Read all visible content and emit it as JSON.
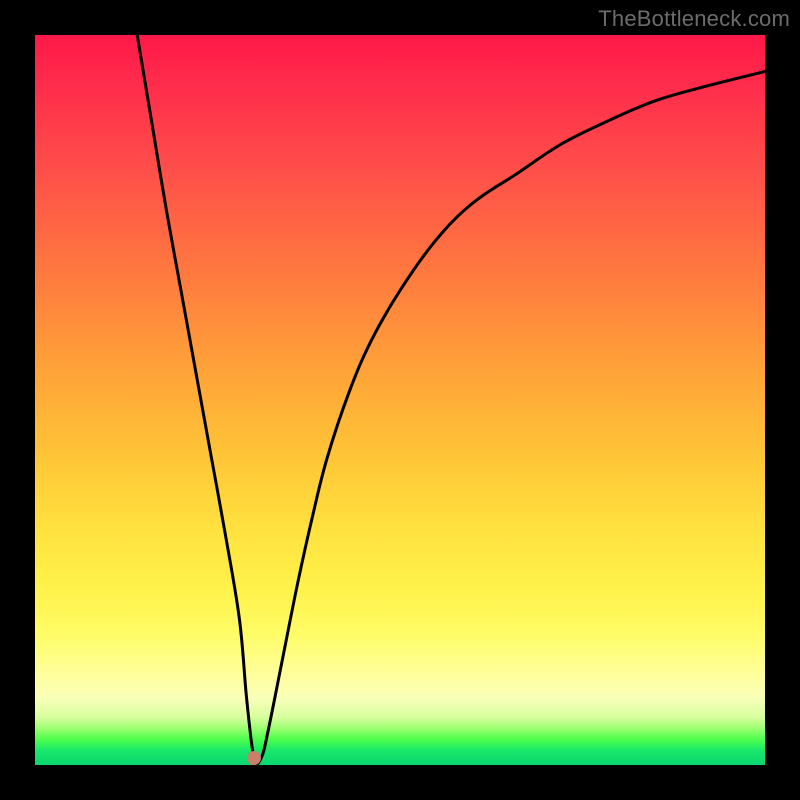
{
  "watermark": "TheBottleneck.com",
  "colors": {
    "frame": "#000000",
    "curve_stroke": "#000000",
    "dot_fill": "#c97f6a"
  },
  "chart_data": {
    "type": "line",
    "title": "",
    "xlabel": "",
    "ylabel": "",
    "xlim": [
      0,
      100
    ],
    "ylim": [
      0,
      100
    ],
    "annotations": [],
    "marker": {
      "x": 30,
      "y": 1
    },
    "series": [
      {
        "name": "curve",
        "x": [
          14,
          16,
          18,
          20,
          22,
          24,
          26,
          28,
          29,
          30,
          31,
          32,
          34,
          36,
          38,
          40,
          43,
          46,
          50,
          55,
          60,
          66,
          72,
          78,
          85,
          92,
          100
        ],
        "values": [
          100,
          88,
          76,
          65,
          54,
          43,
          32,
          20,
          9,
          1,
          1,
          5,
          15,
          25,
          34,
          42,
          51,
          58,
          65,
          72,
          77,
          81,
          85,
          88,
          91,
          93,
          95
        ]
      }
    ]
  }
}
